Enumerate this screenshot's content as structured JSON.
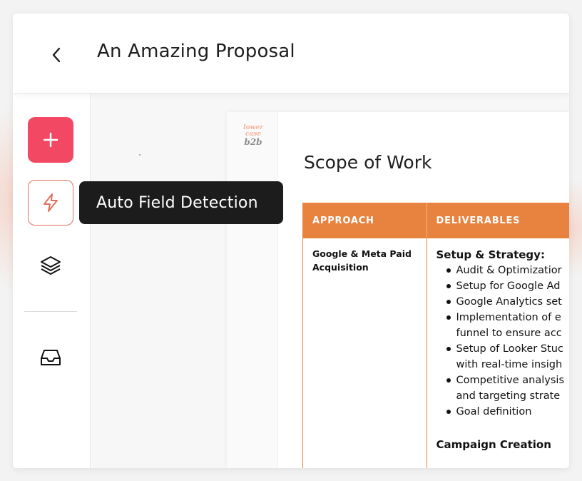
{
  "header": {
    "back_icon": "chevron-left-icon",
    "title": "An Amazing Proposal"
  },
  "sidebar": {
    "add_icon": "plus-icon",
    "auto_detect_icon": "lightning-bolt-icon",
    "layers_icon": "layers-icon",
    "inbox_icon": "inbox-icon"
  },
  "tooltip": {
    "text": "Auto Field Detection"
  },
  "document": {
    "logo": {
      "line1": "lower",
      "line2": "case",
      "line3": "b2b"
    },
    "heading": "Scope of Work",
    "table": {
      "headers": [
        "APPROACH",
        "DELIVERABLES"
      ],
      "approach": "Google & Meta Paid Acquisition",
      "section1_title": "Setup & Strategy:",
      "section1_items": [
        "Audit & Optimizatior",
        "Setup for Google Ad",
        "Google Analytics set",
        "Implementation of e",
        "funnel to ensure acc",
        "Setup of Looker Stuc",
        "with real-time insigh",
        "Competitive analysis",
        "and targeting strate",
        "Goal definition"
      ],
      "section2_title": "Campaign Creation"
    }
  },
  "colors": {
    "accent_pink": "#f24863",
    "accent_orange": "#e8833f",
    "tooltip_bg": "#1c1c1c"
  }
}
